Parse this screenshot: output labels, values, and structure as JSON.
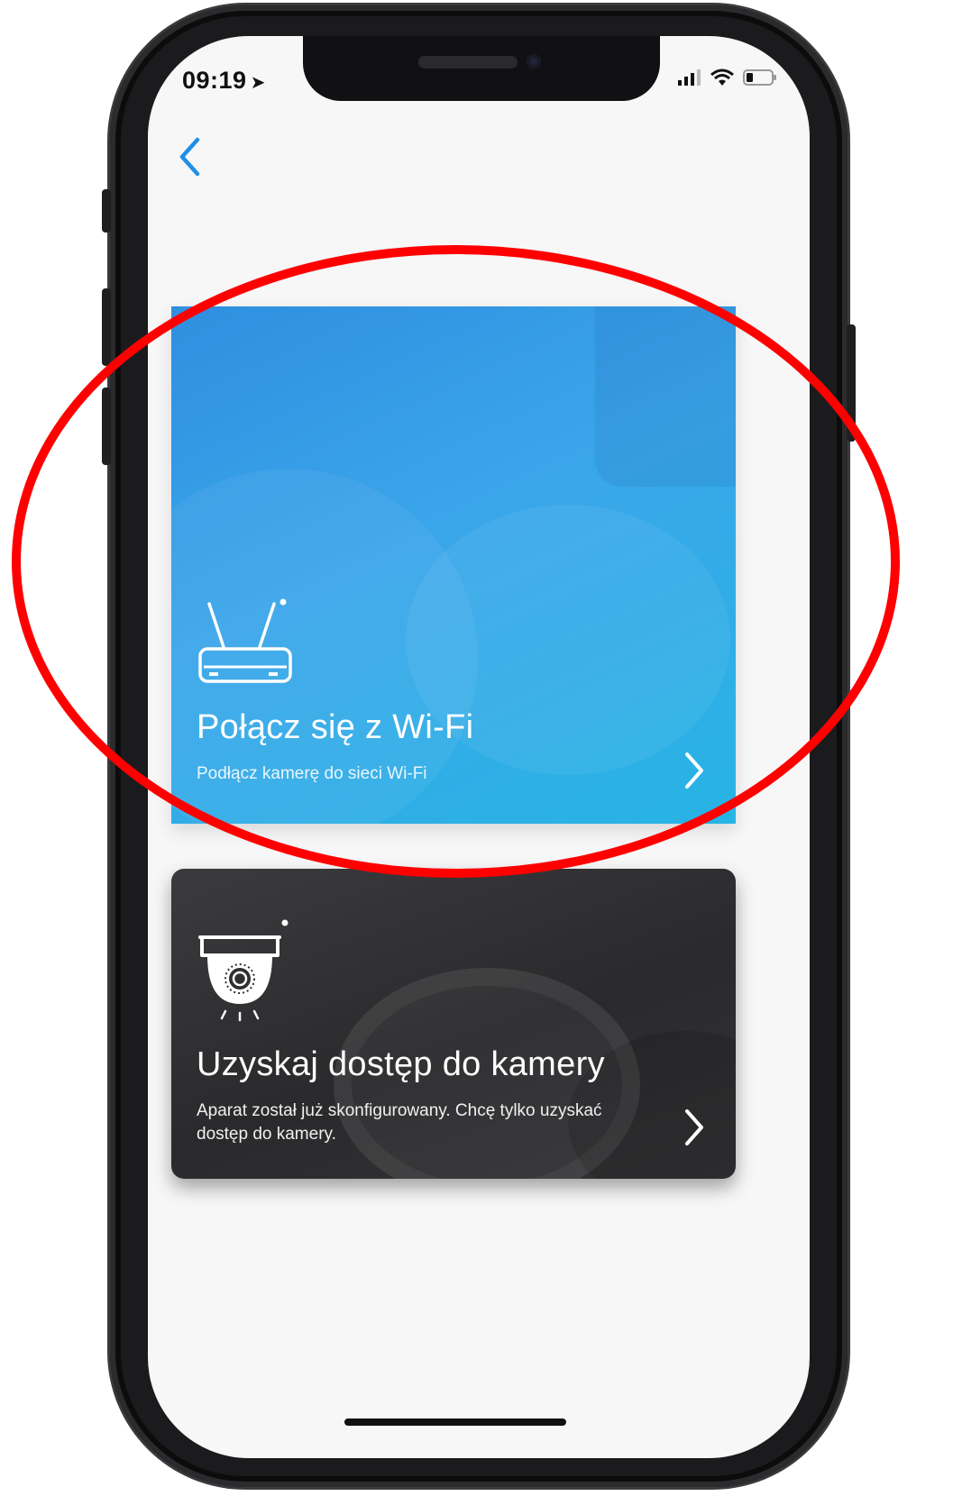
{
  "status_bar": {
    "time": "09:19",
    "location_glyph": "➤"
  },
  "nav": {
    "back_icon": "chevron-left-icon"
  },
  "cards": {
    "wifi": {
      "title": "Połącz się z Wi-Fi",
      "subtitle": "Podłącz kamerę do sieci Wi-Fi",
      "icon": "router-icon",
      "color_start": "#2f8fe0",
      "color_end": "#27b4e4"
    },
    "access": {
      "title": "Uzyskaj dostęp do kamery",
      "subtitle": "Aparat został już skonfigurowany. Chcę tylko uzyskać dostęp do kamery.",
      "icon": "dome-camera-icon",
      "color": "#2f2f31"
    }
  },
  "annotation": {
    "shape": "ellipse",
    "color": "#ff0000"
  }
}
